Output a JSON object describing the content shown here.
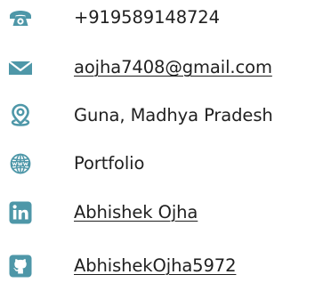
{
  "contacts": [
    {
      "icon": "phone-icon",
      "text": "+919589148724"
    },
    {
      "icon": "mail-icon",
      "text": "aojha7408@gmail.com"
    },
    {
      "icon": "location-pin-icon",
      "text": "Guna, Madhya Pradesh"
    },
    {
      "icon": "globe-icon",
      "text": "Portfolio"
    },
    {
      "icon": "linkedin-icon",
      "text": "Abhishek Ojha"
    },
    {
      "icon": "github-icon",
      "text": "AbhishekOjha5972"
    }
  ],
  "colors": {
    "icon": "#4e97a8",
    "text": "#1f1f1f"
  }
}
